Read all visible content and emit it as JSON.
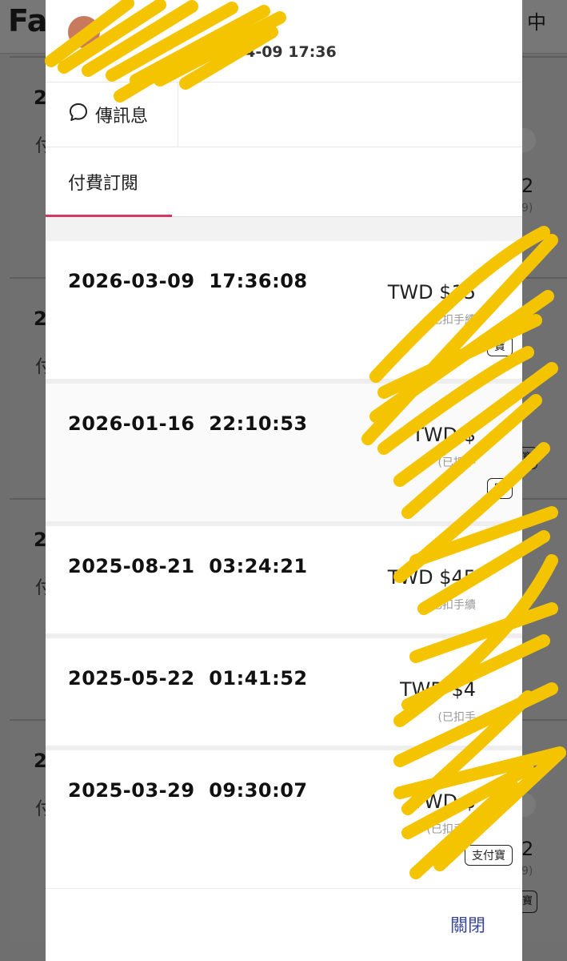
{
  "background": {
    "logo_text": "Fa",
    "status_text": "中",
    "row_prefix": "2",
    "row_label_prefix": "付",
    "right_amount_fragment": "2",
    "right_sub_fragment": "9)",
    "tag_fragment": "寶"
  },
  "modal": {
    "header_date": "-04-09 17:36",
    "message_button_label": "傳訊息",
    "tab_label": "付費訂閱",
    "close_label": "關閉"
  },
  "transactions": [
    {
      "datetime": "2026-03-09  17:36:08",
      "amount": "TWD $15",
      "fee": "(已扣手續",
      "fee_end": "9)",
      "method": "寶"
    },
    {
      "datetime": "2026-01-16  22:10:53",
      "amount": "TWD $",
      "fee": "(已扣手",
      "fee_end": "",
      "method": "寶"
    },
    {
      "datetime": "2025-08-21  03:24:21",
      "amount": "TWD $45",
      "fee": "(已扣手續",
      "fee_end": "",
      "method": ""
    },
    {
      "datetime": "2025-05-22  01:41:52",
      "amount": "TWD $4",
      "fee": "(已扣手",
      "fee_end": "",
      "method": ""
    },
    {
      "datetime": "2025-03-29  09:30:07",
      "amount": "TWD $",
      "fee": "(已扣手續",
      "fee_end": "21)",
      "method": "支付寶"
    }
  ],
  "colors": {
    "tab_accent": "#d63864",
    "close_text": "#3b4aa0",
    "redaction": "#f5c400"
  }
}
